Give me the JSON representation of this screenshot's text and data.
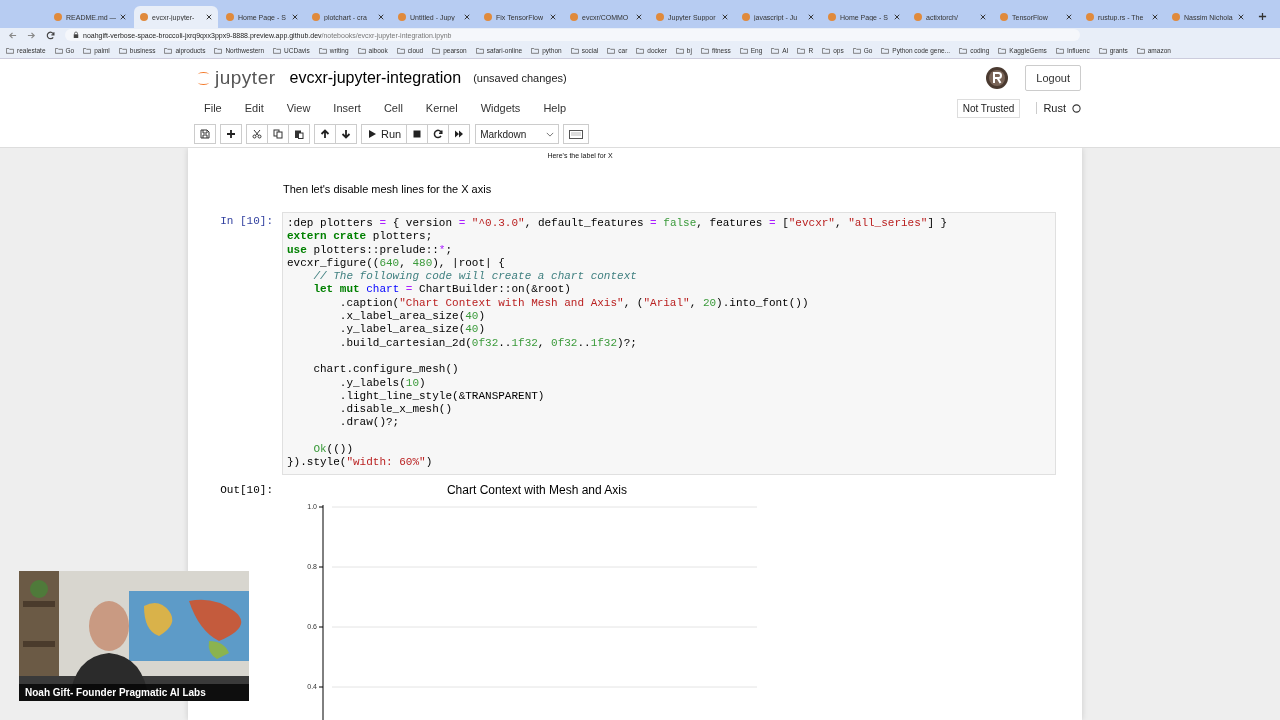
{
  "browser": {
    "tabs": [
      {
        "title": "README.md —",
        "selected": false
      },
      {
        "title": "evcxr-jupyter-",
        "selected": true
      },
      {
        "title": "Home Page - S",
        "selected": false
      },
      {
        "title": "plotchart - cra",
        "selected": false
      },
      {
        "title": "Untitled - Jupy",
        "selected": false
      },
      {
        "title": "Fix TensorFlow",
        "selected": false
      },
      {
        "title": "evcxr/COMMO",
        "selected": false
      },
      {
        "title": "Jupyter Suppor",
        "selected": false
      },
      {
        "title": "javascript - Ju",
        "selected": false
      },
      {
        "title": "Home Page - S",
        "selected": false
      },
      {
        "title": "actixtorch/",
        "selected": false
      },
      {
        "title": "TensorFlow",
        "selected": false
      },
      {
        "title": "rustup.rs - The",
        "selected": false
      },
      {
        "title": "Nassim Nichola",
        "selected": false
      }
    ],
    "url_host": "noahgift-verbose-space-broccoli-jxrq9qxx3ppx9-8888.preview.app.github.dev",
    "url_path": "/notebooks/evcxr-jupyter-integration.ipynb",
    "bookmarks": [
      "realestate",
      "Go",
      "palml",
      "business",
      "aiproducts",
      "Northwestern",
      "UCDavis",
      "writing",
      "aibook",
      "cloud",
      "pearson",
      "safari-online",
      "python",
      "social",
      "car",
      "docker",
      "bj",
      "fitness",
      "Eng",
      "AI",
      "R",
      "ops",
      "Go",
      "Python code gene...",
      "coding",
      "KaggleGems",
      "Influenc",
      "grants",
      "amazon"
    ]
  },
  "jupyter": {
    "logo": "jupyter",
    "notebook_title": "evcxr-jupyter-integration",
    "save_status": "(unsaved changes)",
    "logout": "Logout",
    "menu": [
      "File",
      "Edit",
      "View",
      "Insert",
      "Cell",
      "Kernel",
      "Widgets",
      "Help"
    ],
    "trust": "Not Trusted",
    "kernel": "Rust",
    "run_label": "Run",
    "cell_type": "Markdown"
  },
  "notebook": {
    "prev_output_label": "Here's the label for X",
    "markdown": "Then let's disable mesh lines for the X axis",
    "in_prompt": "In [10]:",
    "out_prompt": "Out[10]:",
    "code": [
      {
        "kind": "code",
        "tokens": [
          {
            "kind": "plain",
            "text": ":dep plotters "
          },
          {
            "kind": "operator",
            "text": "="
          },
          {
            "kind": "plain",
            "text": " { version "
          },
          {
            "kind": "operator",
            "text": "="
          },
          {
            "kind": "string",
            "text": " \"^0.3.0\""
          },
          {
            "kind": "plain",
            "text": ", default_features "
          },
          {
            "kind": "operator",
            "text": "="
          },
          {
            "kind": "number",
            "text": " false"
          },
          {
            "kind": "plain",
            "text": ", features "
          },
          {
            "kind": "operator",
            "text": "="
          },
          {
            "kind": "plain",
            "text": " ["
          },
          {
            "kind": "string",
            "text": "\"evcxr\""
          },
          {
            "kind": "plain",
            "text": ", "
          },
          {
            "kind": "string",
            "text": "\"all_series\""
          },
          {
            "kind": "plain",
            "text": "] }"
          }
        ]
      },
      {
        "kind": "code",
        "tokens": [
          {
            "kind": "keyword",
            "text": "extern crate"
          },
          {
            "kind": "plain",
            "text": " plotters;"
          }
        ]
      },
      {
        "kind": "code",
        "tokens": [
          {
            "kind": "keyword",
            "text": "use"
          },
          {
            "kind": "plain",
            "text": " plotters::prelude::"
          },
          {
            "kind": "operator",
            "text": "*"
          },
          {
            "kind": "plain",
            "text": ";"
          }
        ]
      },
      {
        "kind": "code",
        "tokens": [
          {
            "kind": "plain",
            "text": "evcxr_figure(("
          },
          {
            "kind": "number",
            "text": "640"
          },
          {
            "kind": "plain",
            "text": ", "
          },
          {
            "kind": "number",
            "text": "480"
          },
          {
            "kind": "plain",
            "text": "), |root| {"
          }
        ]
      },
      {
        "kind": "code",
        "tokens": [
          {
            "kind": "comment",
            "text": "    // The following code will create a chart context"
          }
        ]
      },
      {
        "kind": "code",
        "tokens": [
          {
            "kind": "keyword",
            "text": "    let mut"
          },
          {
            "kind": "variable",
            "text": " chart"
          },
          {
            "kind": "operator",
            "text": " ="
          },
          {
            "kind": "plain",
            "text": " ChartBuilder::on(&root)"
          }
        ]
      },
      {
        "kind": "code",
        "tokens": [
          {
            "kind": "plain",
            "text": "        .caption("
          },
          {
            "kind": "string",
            "text": "\"Chart Context with Mesh and Axis\""
          },
          {
            "kind": "plain",
            "text": ", ("
          },
          {
            "kind": "string",
            "text": "\"Arial\""
          },
          {
            "kind": "plain",
            "text": ", "
          },
          {
            "kind": "number",
            "text": "20"
          },
          {
            "kind": "plain",
            "text": ").into_font())"
          }
        ]
      },
      {
        "kind": "code",
        "tokens": [
          {
            "kind": "plain",
            "text": "        .x_label_area_size("
          },
          {
            "kind": "number",
            "text": "40"
          },
          {
            "kind": "plain",
            "text": ")"
          }
        ]
      },
      {
        "kind": "code",
        "tokens": [
          {
            "kind": "plain",
            "text": "        .y_label_area_size("
          },
          {
            "kind": "number",
            "text": "40"
          },
          {
            "kind": "plain",
            "text": ")"
          }
        ]
      },
      {
        "kind": "code",
        "tokens": [
          {
            "kind": "plain",
            "text": "        .build_cartesian_2d("
          },
          {
            "kind": "number",
            "text": "0f32"
          },
          {
            "kind": "plain",
            "text": ".."
          },
          {
            "kind": "number",
            "text": "1f32"
          },
          {
            "kind": "plain",
            "text": ", "
          },
          {
            "kind": "number",
            "text": "0f32"
          },
          {
            "kind": "plain",
            "text": ".."
          },
          {
            "kind": "number",
            "text": "1f32"
          },
          {
            "kind": "plain",
            "text": ")?;"
          }
        ]
      },
      {
        "kind": "blank"
      },
      {
        "kind": "code",
        "tokens": [
          {
            "kind": "plain",
            "text": "    chart.configure_mesh()"
          }
        ]
      },
      {
        "kind": "code",
        "tokens": [
          {
            "kind": "plain",
            "text": "        .y_labels("
          },
          {
            "kind": "number",
            "text": "10"
          },
          {
            "kind": "plain",
            "text": ")"
          }
        ]
      },
      {
        "kind": "code",
        "tokens": [
          {
            "kind": "plain",
            "text": "        .light_line_style(&TRANSPARENT)"
          }
        ]
      },
      {
        "kind": "code",
        "tokens": [
          {
            "kind": "plain",
            "text": "        .disable_x_mesh()"
          }
        ]
      },
      {
        "kind": "code",
        "tokens": [
          {
            "kind": "plain",
            "text": "        .draw()?;"
          }
        ]
      },
      {
        "kind": "blank"
      },
      {
        "kind": "code",
        "tokens": [
          {
            "kind": "number",
            "text": "    Ok"
          },
          {
            "kind": "plain",
            "text": "(())"
          }
        ]
      },
      {
        "kind": "code",
        "tokens": [
          {
            "kind": "plain",
            "text": "}).style("
          },
          {
            "kind": "string",
            "text": "\"width: 60%\""
          },
          {
            "kind": "plain",
            "text": ")"
          }
        ]
      }
    ],
    "plot": {
      "title": "Chart Context with Mesh and Axis",
      "y_tick_labels": [
        "1.0",
        "0.8",
        "0.6",
        "0.4"
      ]
    }
  },
  "webcam": {
    "kind": "picture",
    "caption": "Noah Gift- Founder Pragmatic AI Labs"
  }
}
